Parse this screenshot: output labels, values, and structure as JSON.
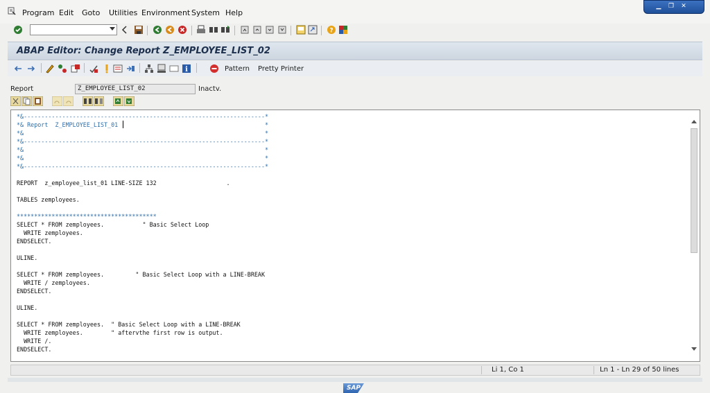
{
  "menu": {
    "items": [
      {
        "label": "Program"
      },
      {
        "label": "Edit"
      },
      {
        "label": "Goto"
      },
      {
        "label": "Utilities"
      },
      {
        "label": "Environment"
      },
      {
        "label": "System"
      },
      {
        "label": "Help"
      }
    ]
  },
  "command_field": {
    "value": ""
  },
  "title": "ABAP Editor: Change Report Z_EMPLOYEE_LIST_02",
  "app_toolbar": {
    "pattern_label": "Pattern",
    "pretty_printer_label": "Pretty Printer"
  },
  "report": {
    "label": "Report",
    "name": "Z_EMPLOYEE_LIST_02",
    "status": "Inactv."
  },
  "code_lines": [
    {
      "text": "*&---------------------------------------------------------------------*",
      "kind": "comment"
    },
    {
      "text": "*& Report  Z_EMPLOYEE_LIST_01                                          *",
      "kind": "comment"
    },
    {
      "text": "*&                                                                     *",
      "kind": "comment"
    },
    {
      "text": "*&---------------------------------------------------------------------*",
      "kind": "comment"
    },
    {
      "text": "*&                                                                     *",
      "kind": "comment"
    },
    {
      "text": "*&                                                                     *",
      "kind": "comment"
    },
    {
      "text": "*&---------------------------------------------------------------------*",
      "kind": "comment"
    },
    {
      "text": "",
      "kind": "normal"
    },
    {
      "text": "REPORT  z_employee_list_01 LINE-SIZE 132                    .",
      "kind": "normal"
    },
    {
      "text": "",
      "kind": "normal"
    },
    {
      "text": "TABLES zemployees.",
      "kind": "normal"
    },
    {
      "text": "",
      "kind": "normal"
    },
    {
      "text": "****************************************",
      "kind": "comment"
    },
    {
      "text": "SELECT * FROM zemployees.           \" Basic Select Loop",
      "kind": "normal"
    },
    {
      "text": "  WRITE zemployees.",
      "kind": "normal"
    },
    {
      "text": "ENDSELECT.",
      "kind": "normal"
    },
    {
      "text": "",
      "kind": "normal"
    },
    {
      "text": "ULINE.",
      "kind": "normal"
    },
    {
      "text": "",
      "kind": "normal"
    },
    {
      "text": "SELECT * FROM zemployees.         \" Basic Select Loop with a LINE-BREAK",
      "kind": "normal"
    },
    {
      "text": "  WRITE / zemployees.",
      "kind": "normal"
    },
    {
      "text": "ENDSELECT.",
      "kind": "normal"
    },
    {
      "text": "",
      "kind": "normal"
    },
    {
      "text": "ULINE.",
      "kind": "normal"
    },
    {
      "text": "",
      "kind": "normal"
    },
    {
      "text": "SELECT * FROM zemployees.  \" Basic Select Loop with a LINE-BREAK",
      "kind": "normal"
    },
    {
      "text": "  WRITE zemployees.        \" aftervthe first row is output.",
      "kind": "normal"
    },
    {
      "text": "  WRITE /.",
      "kind": "normal"
    },
    {
      "text": "ENDSELECT.",
      "kind": "normal"
    }
  ],
  "status_bar": {
    "cursor_position": "Li 1, Co 1",
    "line_range": "Ln 1 - Ln 29 of 50 lines"
  },
  "logo": "SAP",
  "colors": {
    "comment": "#2f6ea8",
    "title_text": "#1c2f4d",
    "window_controls": "#2a5ba8"
  }
}
